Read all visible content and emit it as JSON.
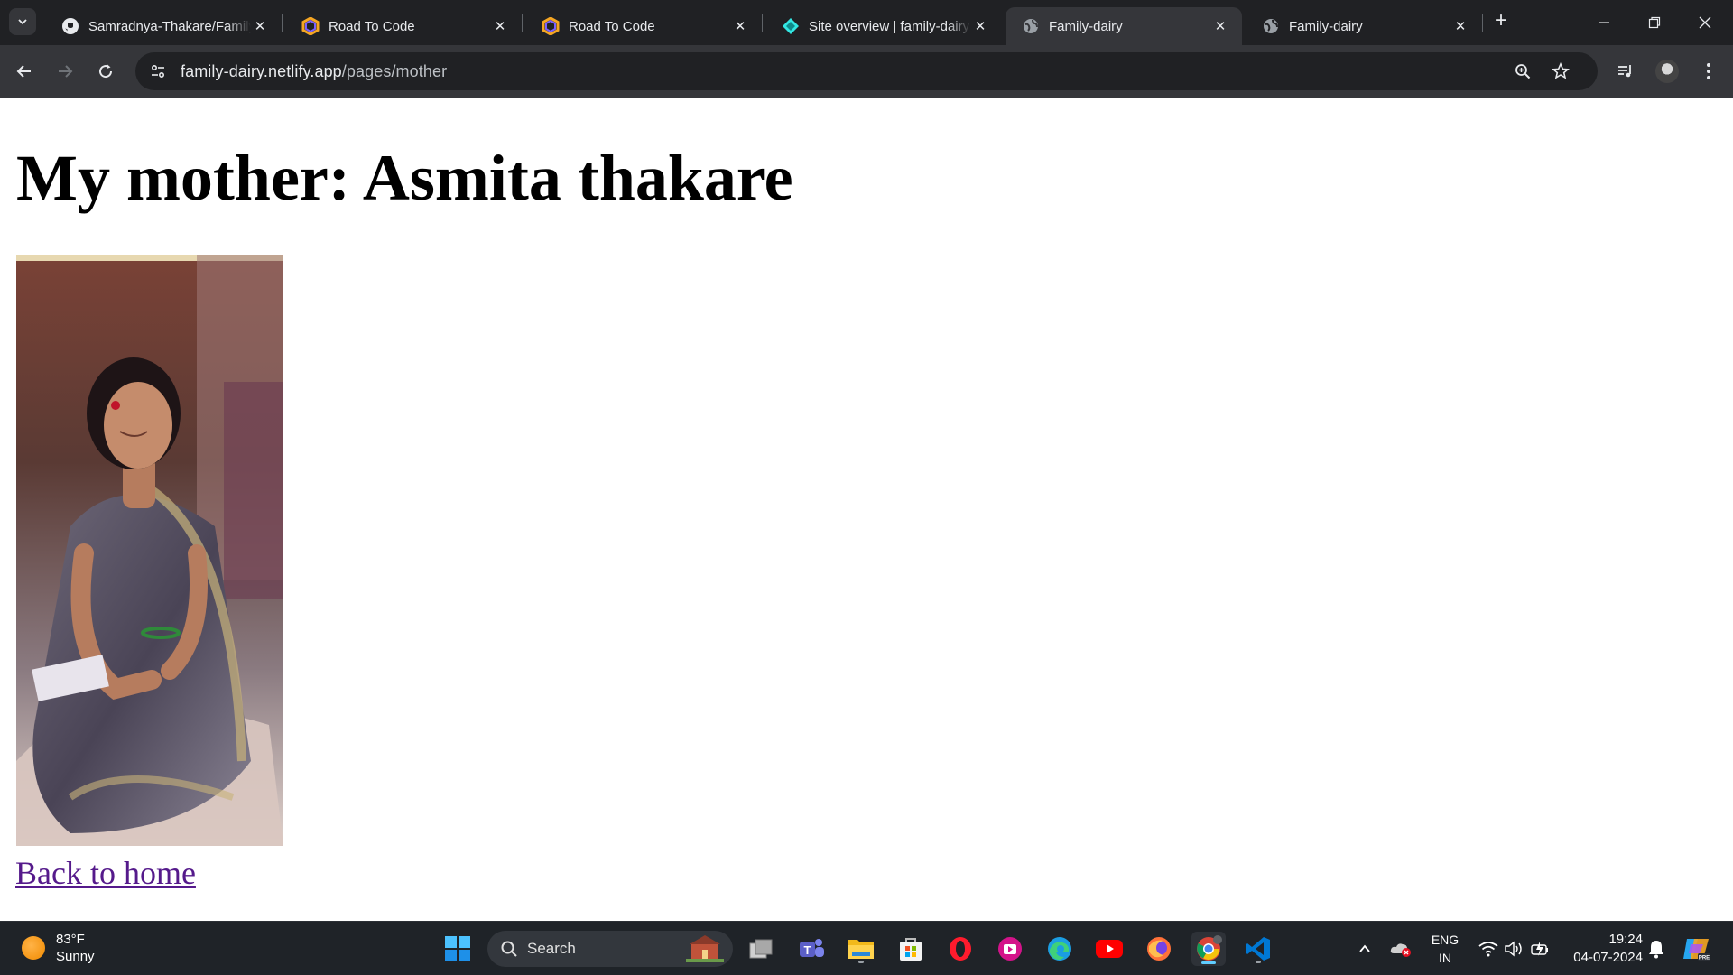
{
  "browser": {
    "tabs": [
      {
        "title": "Samradnya-Thakare/Family",
        "icon": "github-icon",
        "active": false
      },
      {
        "title": "Road To Code",
        "icon": "road-to-code-icon",
        "active": false
      },
      {
        "title": "Road To Code",
        "icon": "road-to-code-icon",
        "active": false
      },
      {
        "title": "Site overview | family-dairy",
        "icon": "netlify-icon",
        "active": false
      },
      {
        "title": "Family-dairy",
        "icon": "globe-icon",
        "active": true
      },
      {
        "title": "Family-dairy",
        "icon": "globe-icon",
        "active": false
      }
    ],
    "address": {
      "host": "family-dairy.netlify.app",
      "path": "/pages/mother"
    }
  },
  "page": {
    "heading": "My mother: Asmita thakare",
    "image_subject": "photo of a woman in a saree seated",
    "back_link": "Back to home"
  },
  "taskbar": {
    "weather": {
      "temp": "83°F",
      "condition": "Sunny"
    },
    "search_placeholder": "Search",
    "language": {
      "line1": "ENG",
      "line2": "IN"
    },
    "clock": {
      "time": "19:24",
      "date": "04-07-2024"
    }
  },
  "colors": {
    "tabstrip": "#202124",
    "toolbar": "#35363a",
    "link_visited": "#551a8b",
    "taskbar": "#1f2328"
  }
}
